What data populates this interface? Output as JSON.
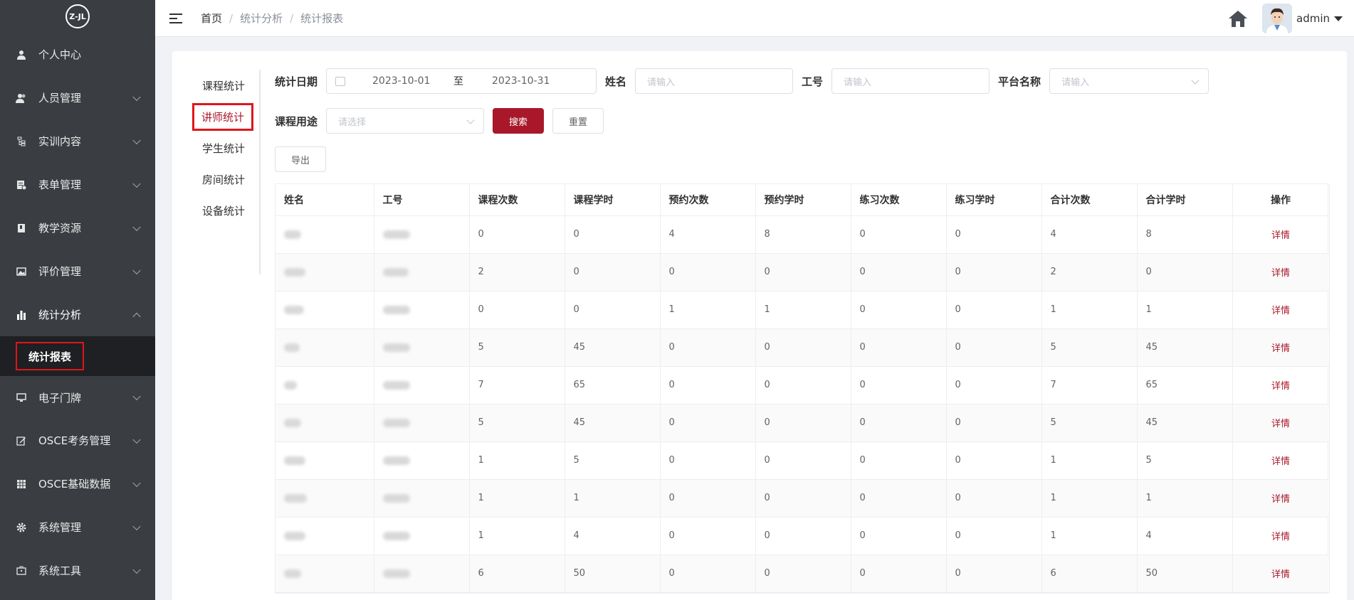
{
  "sidebar": {
    "logo_text": "Z-JL",
    "items": [
      {
        "label": "个人中心",
        "icon": "user-icon",
        "chevron": false
      },
      {
        "label": "人员管理",
        "icon": "users-icon",
        "chevron": true
      },
      {
        "label": "实训内容",
        "icon": "tree-icon",
        "chevron": true
      },
      {
        "label": "表单管理",
        "icon": "form-icon",
        "chevron": true
      },
      {
        "label": "教学资源",
        "icon": "book-icon",
        "chevron": true
      },
      {
        "label": "评价管理",
        "icon": "image-icon",
        "chevron": true
      },
      {
        "label": "统计分析",
        "icon": "bar-chart-icon",
        "chevron": true,
        "expanded": true
      }
    ],
    "sub_item": "统计报表",
    "items_after": [
      {
        "label": "电子门牌",
        "icon": "monitor-icon"
      },
      {
        "label": "OSCE考务管理",
        "icon": "edit-icon"
      },
      {
        "label": "OSCE基础数据",
        "icon": "grid-icon"
      },
      {
        "label": "系统管理",
        "icon": "gear-icon"
      },
      {
        "label": "系统工具",
        "icon": "toolbox-icon"
      }
    ]
  },
  "header": {
    "breadcrumb": [
      "首页",
      "统计分析",
      "统计报表"
    ],
    "breadcrumb_sep": "/",
    "username": "admin"
  },
  "tabs": [
    "课程统计",
    "讲师统计",
    "学生统计",
    "房间统计",
    "设备统计"
  ],
  "active_tab": 1,
  "filters": {
    "date_label": "统计日期",
    "date_start": "2023-10-01",
    "date_to": "至",
    "date_end": "2023-10-31",
    "name_label": "姓名",
    "name_placeholder": "请输入",
    "id_label": "工号",
    "id_placeholder": "请输入",
    "platform_label": "平台名称",
    "platform_placeholder": "请输入",
    "purpose_label": "课程用途",
    "purpose_placeholder": "请选择",
    "search_label": "搜索",
    "reset_label": "重置"
  },
  "export_label": "导出",
  "table": {
    "columns": [
      "姓名",
      "工号",
      "课程次数",
      "课程学时",
      "预约次数",
      "预约学时",
      "练习次数",
      "练习学时",
      "合计次数",
      "合计学时",
      "操作"
    ],
    "action_label": "详情",
    "rows": [
      [
        "0",
        "0",
        "4",
        "8",
        "0",
        "0",
        "4",
        "8"
      ],
      [
        "2",
        "0",
        "0",
        "0",
        "0",
        "0",
        "2",
        "0"
      ],
      [
        "0",
        "0",
        "1",
        "1",
        "0",
        "0",
        "1",
        "1"
      ],
      [
        "5",
        "45",
        "0",
        "0",
        "0",
        "0",
        "5",
        "45"
      ],
      [
        "7",
        "65",
        "0",
        "0",
        "0",
        "0",
        "7",
        "65"
      ],
      [
        "5",
        "45",
        "0",
        "0",
        "0",
        "0",
        "5",
        "45"
      ],
      [
        "1",
        "5",
        "0",
        "0",
        "0",
        "0",
        "1",
        "5"
      ],
      [
        "1",
        "1",
        "0",
        "0",
        "0",
        "0",
        "1",
        "1"
      ],
      [
        "1",
        "4",
        "0",
        "0",
        "0",
        "0",
        "1",
        "4"
      ],
      [
        "6",
        "50",
        "0",
        "0",
        "0",
        "0",
        "6",
        "50"
      ]
    ]
  },
  "colors": {
    "sidebar_bg": "#3a3d42",
    "accent": "#a8182a",
    "highlight_box": "#e0151b"
  }
}
